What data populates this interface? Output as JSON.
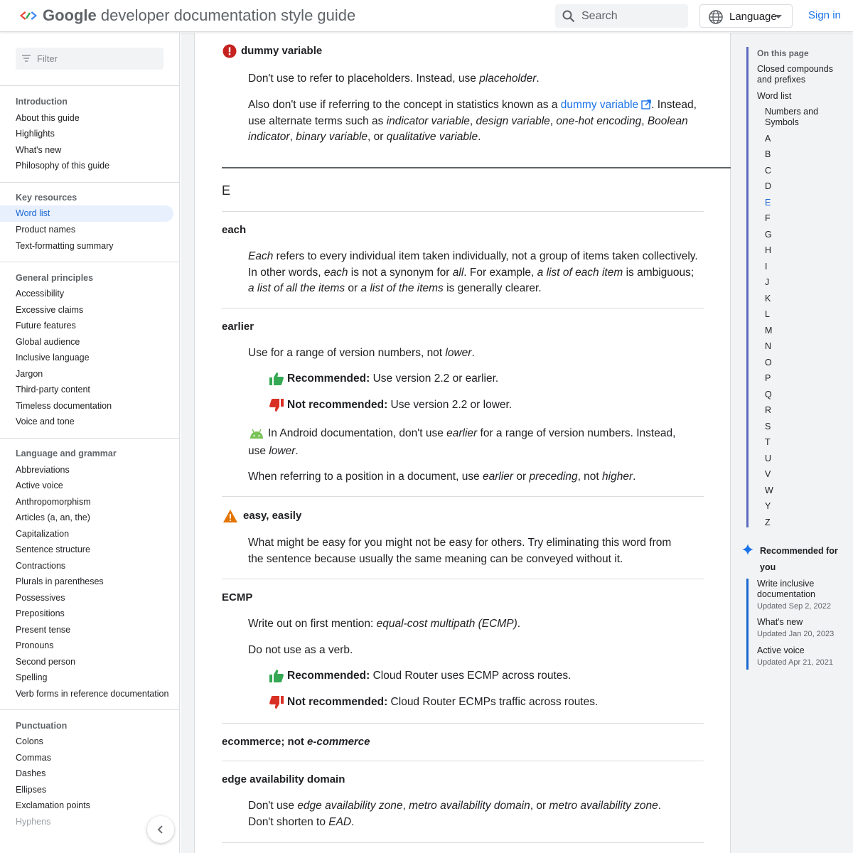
{
  "header": {
    "brand": "Google",
    "title": " developer documentation style guide",
    "search_placeholder": "Search",
    "language_label": "Language",
    "signin_label": "Sign in"
  },
  "leftnav": {
    "filter_placeholder": "Filter",
    "sections": [
      {
        "heading": "Introduction",
        "items": [
          "About this guide",
          "Highlights",
          "What's new",
          "Philosophy of this guide"
        ]
      },
      {
        "heading": "Key resources",
        "items": [
          "Word list",
          "Product names",
          "Text-formatting summary"
        ],
        "active": "Word list"
      },
      {
        "heading": "General principles",
        "items": [
          "Accessibility",
          "Excessive claims",
          "Future features",
          "Global audience",
          "Inclusive language",
          "Jargon",
          "Third-party content",
          "Timeless documentation",
          "Voice and tone"
        ]
      },
      {
        "heading": "Language and grammar",
        "items": [
          "Abbreviations",
          "Active voice",
          "Anthropomorphism",
          "Articles (a, an, the)",
          "Capitalization",
          "Sentence structure",
          "Contractions",
          "Plurals in parentheses",
          "Possessives",
          "Prepositions",
          "Present tense",
          "Pronouns",
          "Second person",
          "Spelling",
          "Verb forms in reference documentation"
        ]
      },
      {
        "heading": "Punctuation",
        "items": [
          "Colons",
          "Commas",
          "Dashes",
          "Ellipses",
          "Exclamation points",
          "Hyphens"
        ]
      }
    ]
  },
  "main": {
    "dummy": {
      "term": "dummy variable",
      "p1_a": "Don't use to refer to placeholders. Instead, use ",
      "p1_i": "placeholder",
      "p1_b": ".",
      "p2_a": "Also don't use if referring to the concept in statistics known as a ",
      "p2_link": "dummy variable",
      "p2_b": ". Instead, use alternate terms such as ",
      "alt1": "indicator variable",
      "alt2": "design variable",
      "alt3": "one-hot encoding",
      "alt4": "Boolean indicator",
      "alt5": "binary variable",
      "alt6": "qualitative variable",
      "sep": ", ",
      "or": ", or ",
      "end": "."
    },
    "letter": "E",
    "each": {
      "term": "each",
      "i1": "Each",
      "t1": " refers to every individual item taken individually, not a group of items taken collectively. In other words, ",
      "i2": "each",
      "t2": " is not a synonym for ",
      "i3": "all",
      "t3": ". For example, ",
      "i4": "a list of each item",
      "t4": " is ambiguous; ",
      "i5": "a list of all the items",
      "t5": " or ",
      "i6": "a list of the items",
      "t6": " is generally clearer."
    },
    "earlier": {
      "term": "earlier",
      "p1_a": "Use for a range of version numbers, not ",
      "p1_i": "lower",
      "p1_b": ".",
      "rec_label": "Recommended:",
      "rec_text": " Use version 2.2 or earlier.",
      "notrec_label": "Not recommended:",
      "notrec_text": " Use version 2.2 or lower.",
      "android_a": " In Android documentation, don't use ",
      "android_i1": "earlier",
      "android_b": " for a range of version numbers. Instead, use ",
      "android_i2": "lower",
      "android_c": ".",
      "pos_a": "When referring to a position in a document, use ",
      "pos_i1": "earlier",
      "pos_b": " or ",
      "pos_i2": "preceding",
      "pos_c": ", not ",
      "pos_i3": "higher",
      "pos_d": "."
    },
    "easy": {
      "term": "easy, easily",
      "p1": "What might be easy for you might not be easy for others. Try eliminating this word from the sentence because usually the same meaning can be conveyed without it."
    },
    "ecmp": {
      "term": "ECMP",
      "p1_a": "Write out on first mention: ",
      "p1_i": "equal-cost multipath (ECMP)",
      "p1_b": ".",
      "p2": "Do not use as a verb.",
      "rec_label": "Recommended:",
      "rec_text": " Cloud Router uses ECMP across routes.",
      "notrec_label": "Not recommended:",
      "notrec_text": " Cloud Router ECMPs traffic across routes."
    },
    "ecommerce": {
      "term_a": "ecommerce; not ",
      "term_i": "e-commerce"
    },
    "edge": {
      "term": "edge availability domain",
      "a": "Don't use ",
      "i1": "edge availability zone",
      "b": ", ",
      "i2": "metro availability domain",
      "c": ", or ",
      "i3": "metro availability zone",
      "d": ". Don't shorten to ",
      "i4": "EAD",
      "e": "."
    }
  },
  "toc": {
    "title": "On this page",
    "items": [
      "Closed compounds and prefixes",
      "Word list",
      "Numbers and Symbols"
    ],
    "letters": [
      "A",
      "B",
      "C",
      "D",
      "E",
      "F",
      "G",
      "H",
      "I",
      "J",
      "K",
      "L",
      "M",
      "N",
      "O",
      "P",
      "Q",
      "R",
      "S",
      "T",
      "U",
      "V",
      "W",
      "Y",
      "Z"
    ],
    "active_letter": "E",
    "recommended_heading": "Recommended for you",
    "recommended": [
      {
        "title": "Write inclusive documentation",
        "date": "Updated Sep 2, 2022"
      },
      {
        "title": "What's new",
        "date": "Updated Jan 20, 2023"
      },
      {
        "title": "Active voice",
        "date": "Updated Apr 21, 2021"
      }
    ]
  },
  "colors": {
    "link": "#1a73e8",
    "recommended": "#34a853",
    "not_recommended": "#d93025",
    "warning": "#e37400",
    "error": "#c5221f",
    "toc_bar": "#5c6bc0"
  }
}
